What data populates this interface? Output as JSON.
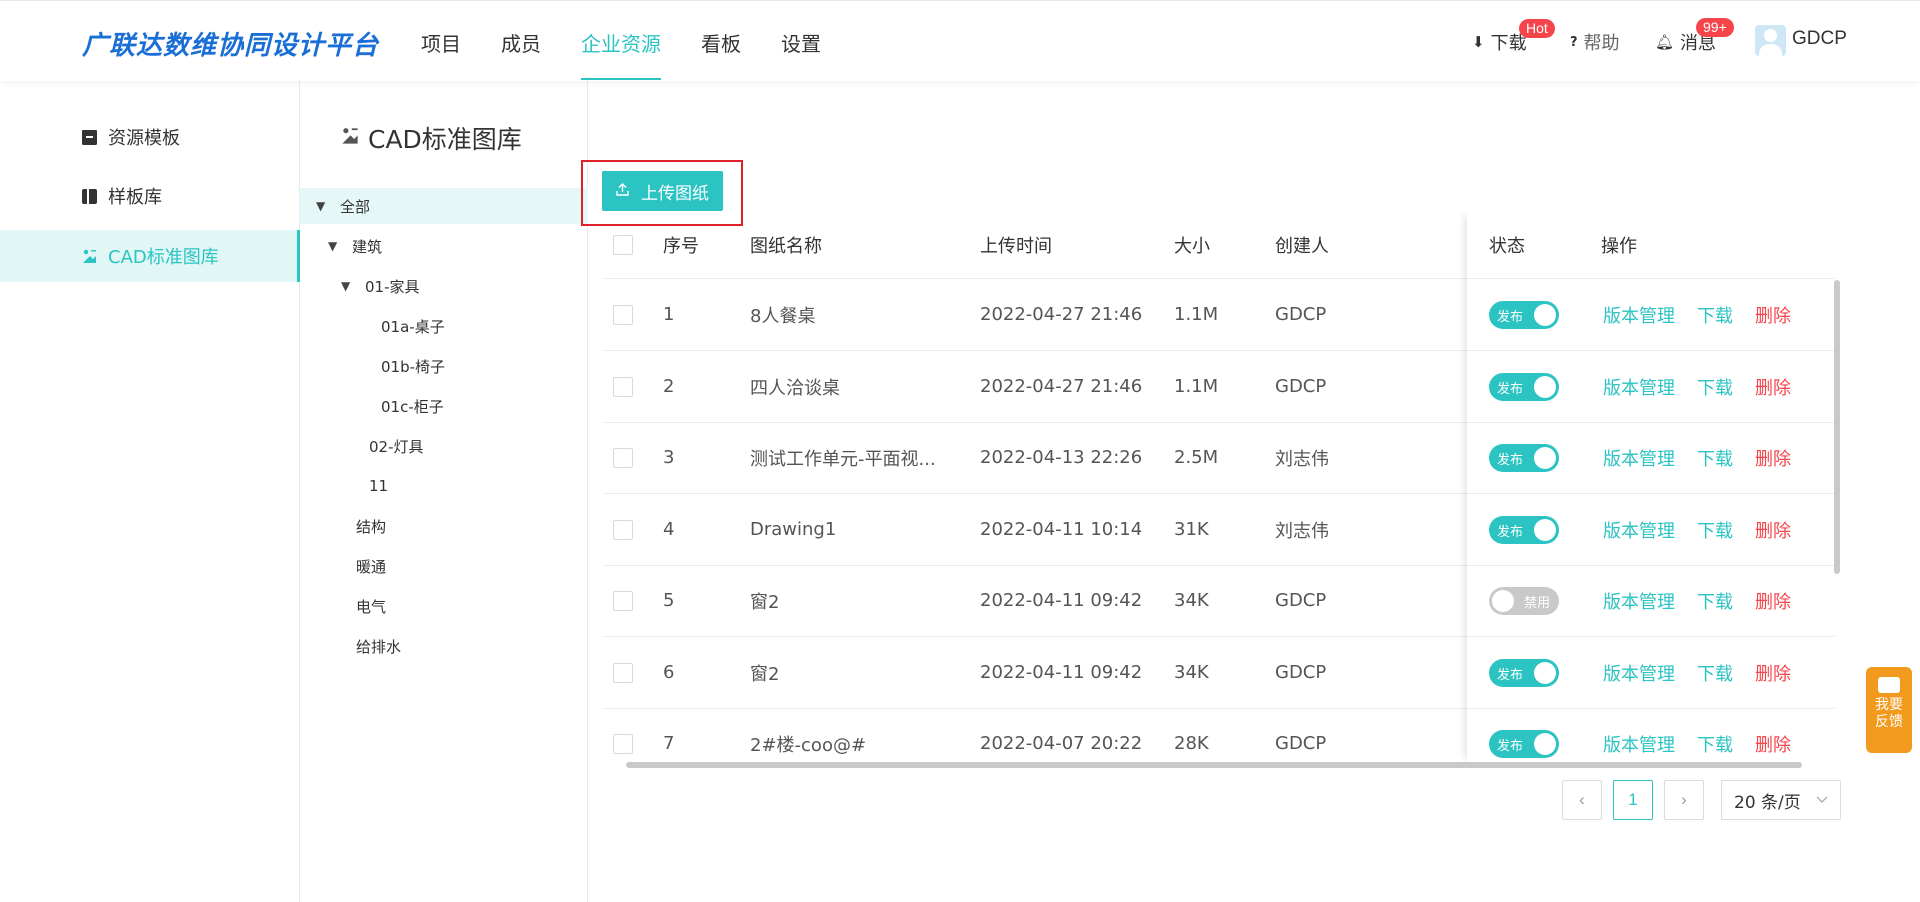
{
  "header": {
    "logo": "广联达数维协同设计平台",
    "nav": [
      "项目",
      "成员",
      "企业资源",
      "看板",
      "设置"
    ],
    "active_nav": "企业资源",
    "download_label": "下载",
    "download_badge": "Hot",
    "help_label": "帮助",
    "messages_label": "消息",
    "messages_badge": "99+",
    "username": "GDCP"
  },
  "sidebar": {
    "items": [
      {
        "label": "资源模板",
        "icon": "box-icon"
      },
      {
        "label": "样板库",
        "icon": "book-icon"
      },
      {
        "label": "CAD标准图库",
        "icon": "cad-icon"
      }
    ],
    "active": "CAD标准图库"
  },
  "page": {
    "title": "CAD标准图库",
    "upload_label": "上传图纸"
  },
  "tree": [
    {
      "label": "全部",
      "caret": "down",
      "selected": true
    },
    {
      "label": "建筑",
      "caret": "down"
    },
    {
      "label": "01-家具",
      "caret": "down"
    },
    {
      "label": "01a-桌子"
    },
    {
      "label": "01b-椅子"
    },
    {
      "label": "01c-柜子"
    },
    {
      "label": "02-灯具"
    },
    {
      "label": "11"
    },
    {
      "label": "结构"
    },
    {
      "label": "暖通"
    },
    {
      "label": "电气"
    },
    {
      "label": "给排水"
    }
  ],
  "table": {
    "columns": {
      "no": "序号",
      "name": "图纸名称",
      "time": "上传时间",
      "size": "大小",
      "creator": "创建人",
      "status": "状态",
      "ops": "操作"
    },
    "rows": [
      {
        "no": "1",
        "name": "8人餐桌",
        "time": "2022-04-27 21:46",
        "size": "1.1M",
        "creator": "GDCP",
        "status": "发布",
        "enabled": true
      },
      {
        "no": "2",
        "name": "四人洽谈桌",
        "time": "2022-04-27 21:46",
        "size": "1.1M",
        "creator": "GDCP",
        "status": "发布",
        "enabled": true
      },
      {
        "no": "3",
        "name": "测试工作单元-平面视...",
        "time": "2022-04-13 22:26",
        "size": "2.5M",
        "creator": "刘志伟",
        "status": "发布",
        "enabled": true
      },
      {
        "no": "4",
        "name": "Drawing1",
        "time": "2022-04-11 10:14",
        "size": "31K",
        "creator": "刘志伟",
        "status": "发布",
        "enabled": true
      },
      {
        "no": "5",
        "name": "窗2",
        "time": "2022-04-11 09:42",
        "size": "34K",
        "creator": "GDCP",
        "status": "禁用",
        "enabled": false
      },
      {
        "no": "6",
        "name": "窗2",
        "time": "2022-04-11 09:42",
        "size": "34K",
        "creator": "GDCP",
        "status": "发布",
        "enabled": true
      },
      {
        "no": "7",
        "name": "2#楼-coo@#",
        "time": "2022-04-07 20:22",
        "size": "28K",
        "creator": "GDCP",
        "status": "发布",
        "enabled": true
      }
    ],
    "actions": {
      "version": "版本管理",
      "download": "下载",
      "delete": "删除"
    }
  },
  "pagination": {
    "prev": "‹",
    "current": "1",
    "next": "›",
    "page_size": "20 条/页"
  },
  "feedback": {
    "line1": "我要",
    "line2": "反馈"
  },
  "colors": {
    "accent": "#2cc3c3",
    "danger": "#f5454b",
    "logo": "#1a6fd6",
    "feedback": "#f29a1d",
    "highlight": "#e0202a"
  }
}
